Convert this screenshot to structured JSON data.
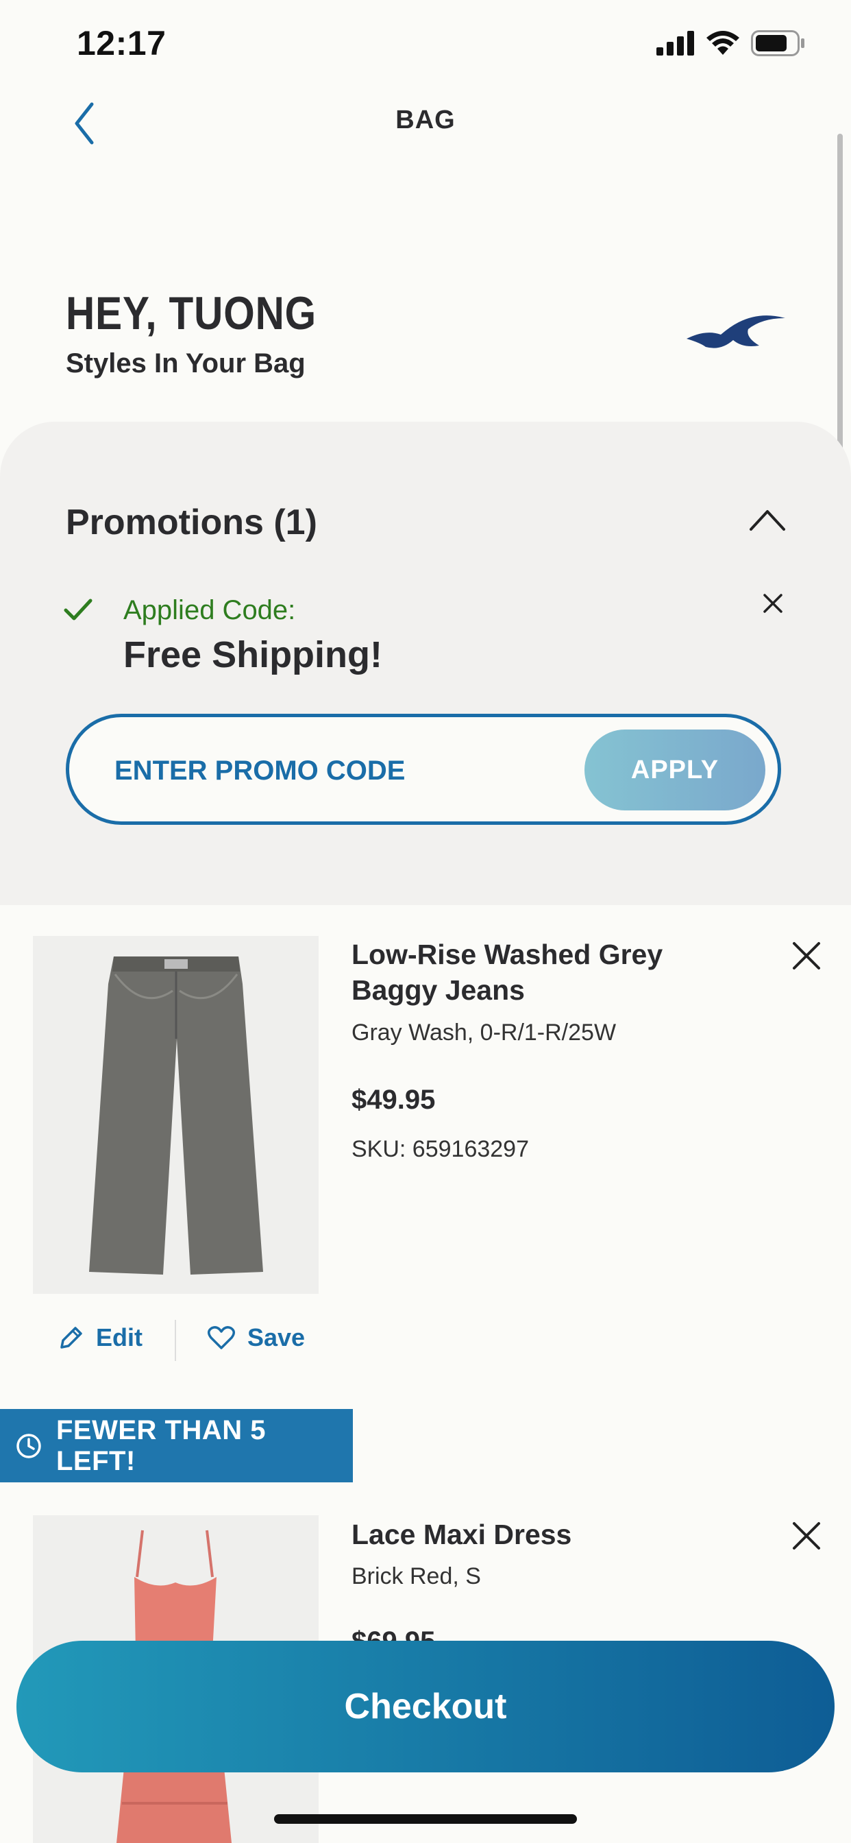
{
  "status_bar": {
    "time": "12:17",
    "icons": [
      "signal-icon",
      "wifi-icon",
      "battery-icon"
    ]
  },
  "nav": {
    "title": "BAG",
    "back_icon": "chevron-left-icon"
  },
  "greeting": {
    "title": "HEY, TUONG",
    "subtitle": "Styles In Your Bag"
  },
  "promotions": {
    "title": "Promotions (1)",
    "applied_label": "Applied Code:",
    "applied_code": "Free Shipping!",
    "input_placeholder": "ENTER PROMO CODE",
    "apply_label": "APPLY"
  },
  "items": [
    {
      "name_line1": "Low-Rise Washed Grey",
      "name_line2": "Baggy Jeans",
      "variant": "Gray Wash, 0-R/1-R/25W",
      "price": "$49.95",
      "sku": "SKU: 659163297",
      "edit_label": "Edit",
      "save_label": "Save"
    },
    {
      "badge": "FEWER THAN 5 LEFT!",
      "name_line1": "Lace Maxi Dress",
      "variant": "Brick Red, S",
      "price": "$69.95"
    }
  ],
  "checkout_label": "Checkout",
  "colors": {
    "brand_blue": "#1a6da8",
    "success_green": "#2e7d1f",
    "badge_blue": "#1f76ad"
  }
}
